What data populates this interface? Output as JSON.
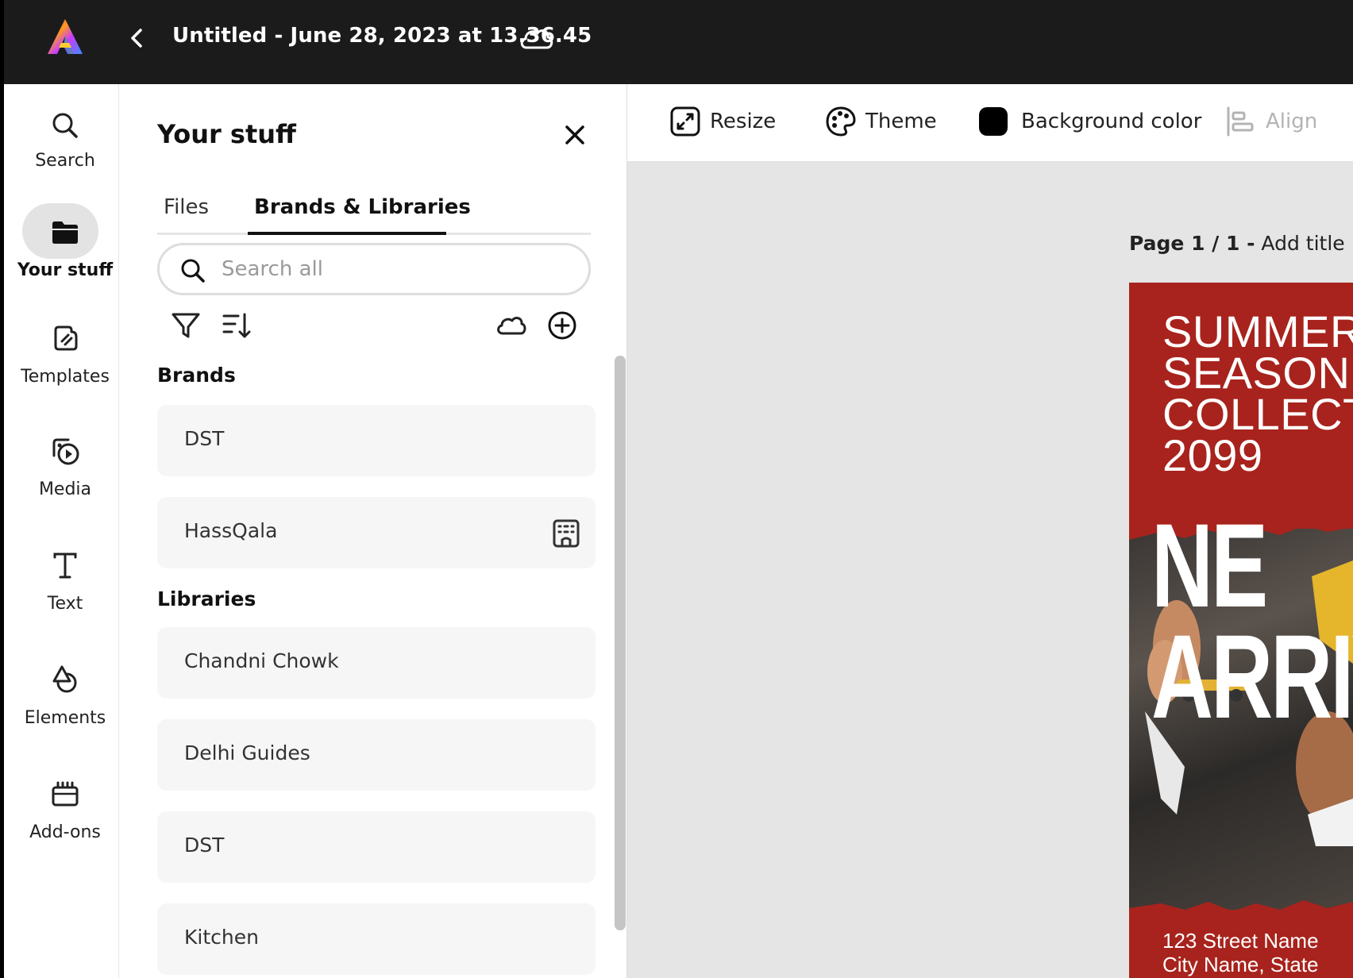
{
  "app": {
    "document_title": "Untitled - June 28, 2023 at 13.36.45"
  },
  "rail": {
    "items": [
      {
        "label": "Search",
        "icon": "search-icon"
      },
      {
        "label": "Your stuff",
        "icon": "folder-icon",
        "active": true
      },
      {
        "label": "Templates",
        "icon": "templates-icon"
      },
      {
        "label": "Media",
        "icon": "media-icon"
      },
      {
        "label": "Text",
        "icon": "text-icon"
      },
      {
        "label": "Elements",
        "icon": "elements-icon"
      },
      {
        "label": "Add-ons",
        "icon": "add-ons-icon"
      }
    ]
  },
  "panel": {
    "title": "Your stuff",
    "tabs": [
      {
        "label": "Files"
      },
      {
        "label": "Brands & Libraries",
        "active": true
      }
    ],
    "search": {
      "placeholder": "Search all",
      "value": ""
    },
    "sections": {
      "brands": {
        "title": "Brands",
        "items": [
          {
            "name": "DST"
          },
          {
            "name": "HassQala",
            "icon": "building-icon"
          }
        ]
      },
      "libraries": {
        "title": "Libraries",
        "items": [
          {
            "name": "Chandni Chowk"
          },
          {
            "name": "Delhi Guides"
          },
          {
            "name": "DST"
          },
          {
            "name": "Kitchen"
          }
        ]
      }
    }
  },
  "canvas_toolbar": {
    "items": [
      {
        "label": "Resize",
        "icon": "resize-icon"
      },
      {
        "label": "Theme",
        "icon": "palette-icon"
      },
      {
        "label": "Background color",
        "icon": "color-swatch-icon",
        "swatch": "#000000"
      },
      {
        "label": "Align",
        "icon": "align-icon",
        "disabled": true
      }
    ]
  },
  "page": {
    "label_bold": "Page 1 / 1 -",
    "label_rest": " Add title"
  },
  "poster": {
    "heading": "SUMMER\nSEASON\nCOLLECT\n2099",
    "big_line1": "NE",
    "big_line2": "ARRIV",
    "address": "123 Street Name\nCity Name, State",
    "background": "#a8231d"
  }
}
